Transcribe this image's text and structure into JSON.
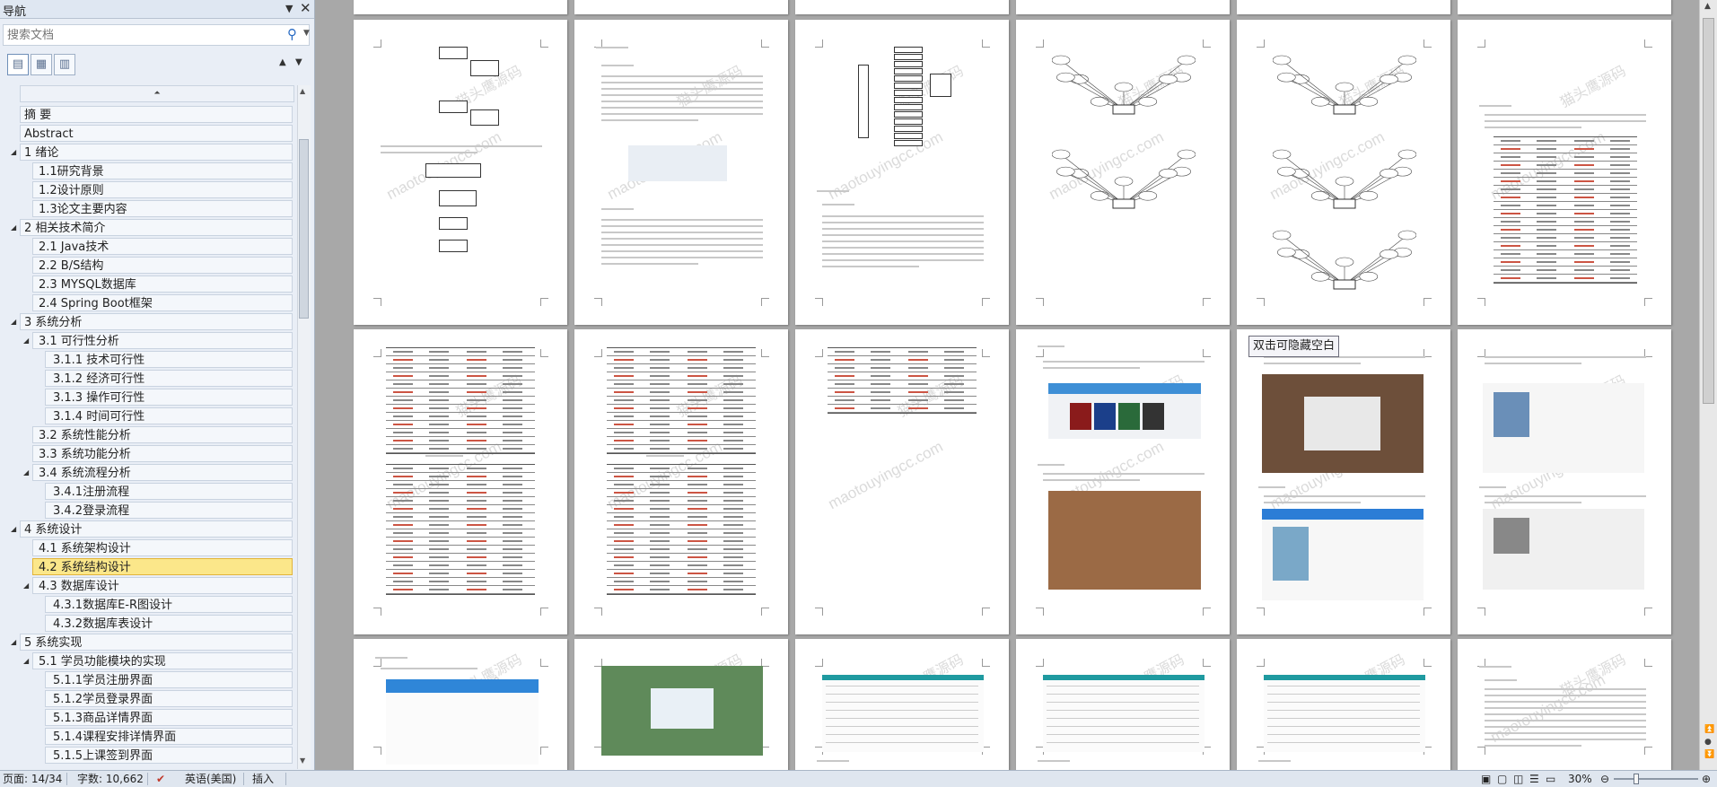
{
  "nav": {
    "title": "导航",
    "search_placeholder": "搜索文档",
    "outline": [
      {
        "label": "摘 要",
        "level": 1
      },
      {
        "label": "Abstract",
        "level": 1
      },
      {
        "label": "1 绪论",
        "level": 1
      },
      {
        "label": "1.1研究背景",
        "level": 2
      },
      {
        "label": "1.2设计原则",
        "level": 2
      },
      {
        "label": "1.3论文主要内容",
        "level": 2
      },
      {
        "label": "2 相关技术简介",
        "level": 1
      },
      {
        "label": "2.1 Java技术",
        "level": 2
      },
      {
        "label": "2.2 B/S结构",
        "level": 2
      },
      {
        "label": "2.3 MYSQL数据库",
        "level": 2
      },
      {
        "label": "2.4 Spring Boot框架",
        "level": 2
      },
      {
        "label": "3 系统分析",
        "level": 1
      },
      {
        "label": "3.1 可行性分析",
        "level": 2
      },
      {
        "label": "3.1.1 技术可行性",
        "level": 3
      },
      {
        "label": "3.1.2 经济可行性",
        "level": 3
      },
      {
        "label": "3.1.3 操作可行性",
        "level": 3
      },
      {
        "label": "3.1.4 时间可行性",
        "level": 3
      },
      {
        "label": "3.2 系统性能分析",
        "level": 2
      },
      {
        "label": "3.3 系统功能分析",
        "level": 2
      },
      {
        "label": "3.4 系统流程分析",
        "level": 2
      },
      {
        "label": "3.4.1注册流程",
        "level": 3
      },
      {
        "label": "3.4.2登录流程",
        "level": 3
      },
      {
        "label": "4 系统设计",
        "level": 1
      },
      {
        "label": "4.1 系统架构设计",
        "level": 2
      },
      {
        "label": "4.2 系统结构设计",
        "level": 2,
        "selected": true
      },
      {
        "label": "4.3 数据库设计",
        "level": 2
      },
      {
        "label": "4.3.1数据库E-R图设计",
        "level": 3
      },
      {
        "label": "4.3.2数据库表设计",
        "level": 3
      },
      {
        "label": "5 系统实现",
        "level": 1
      },
      {
        "label": "5.1 学员功能模块的实现",
        "level": 2
      },
      {
        "label": "5.1.1学员注册界面",
        "level": 3
      },
      {
        "label": "5.1.2学员登录界面",
        "level": 3
      },
      {
        "label": "5.1.3商品详情界面",
        "level": 3
      },
      {
        "label": "5.1.4课程安排详情界面",
        "level": 3
      },
      {
        "label": "5.1.5上课签到界面",
        "level": 3
      }
    ]
  },
  "document": {
    "watermark": "maotouyingcc.com",
    "watermark_cn": "猫头鹰源码",
    "tooltip": "双击可隐藏空白"
  },
  "status": {
    "page": "页面: 14/34",
    "words": "字数: 10,662",
    "language": "英语(美国)",
    "mode": "插入",
    "zoom": "30%"
  }
}
